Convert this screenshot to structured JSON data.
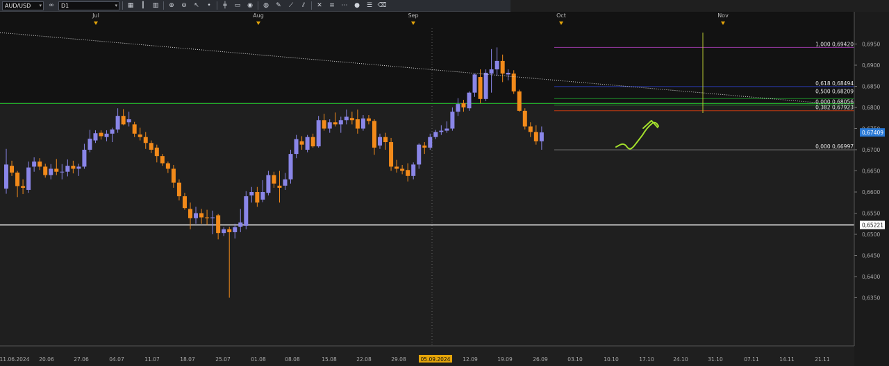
{
  "toolbar": {
    "symbol": "AUD/USD",
    "timeframe": "D1",
    "buttons": [
      {
        "name": "chart-type-icon",
        "glyph": "▦"
      },
      {
        "name": "bar-chart-icon",
        "glyph": "┃"
      },
      {
        "name": "candles-icon",
        "glyph": "▥"
      },
      {
        "name": "zoom-in-icon",
        "glyph": "⊕"
      },
      {
        "name": "zoom-out-icon",
        "glyph": "⊖"
      },
      {
        "name": "cursor-icon",
        "glyph": "↖"
      },
      {
        "name": "dot-icon",
        "glyph": "•"
      },
      {
        "name": "crosshair-icon",
        "glyph": "╪"
      },
      {
        "name": "text-icon",
        "glyph": "▭"
      },
      {
        "name": "eye-icon",
        "glyph": "◉"
      },
      {
        "name": "globe-icon",
        "glyph": "◍"
      },
      {
        "name": "pencil-icon",
        "glyph": "✎"
      },
      {
        "name": "trendline-icon",
        "glyph": "⟋"
      },
      {
        "name": "channel-icon",
        "glyph": "⫽"
      },
      {
        "name": "cross-icon",
        "glyph": "✕"
      },
      {
        "name": "fibonacci-icon",
        "glyph": "≡"
      },
      {
        "name": "grid-icon",
        "glyph": "⋯"
      },
      {
        "name": "circle-icon",
        "glyph": "●"
      },
      {
        "name": "lines-icon",
        "glyph": "☰"
      },
      {
        "name": "eraser-icon",
        "glyph": "⌫"
      }
    ]
  },
  "chart_data": {
    "type": "candlestick",
    "symbol": "AUD/USD",
    "timeframe": "D1",
    "x_labels": [
      "11.06.2024",
      "20.06",
      "27.06",
      "04.07",
      "11.07",
      "18.07",
      "25.07",
      "01.08",
      "08.08",
      "15.08",
      "22.08",
      "29.08",
      "05.09.2024",
      "12.09",
      "19.09",
      "26.09",
      "03.10",
      "10.10",
      "17.10",
      "24.10",
      "31.10",
      "07.11",
      "14.11",
      "21.11"
    ],
    "highlighted_x_label": "05.09.2024",
    "month_labels": [
      "Jul",
      "Aug",
      "Sep",
      "Oct",
      "Nov"
    ],
    "y_ticks": [
      "0,6950",
      "0,6900",
      "0,6850",
      "0,6800",
      "0,6750",
      "0,6700",
      "0,6650",
      "0,6600",
      "0,6550",
      "0,6500",
      "0,6450",
      "0,6400",
      "0,6350"
    ],
    "ylim": [
      0.6331,
      0.6982
    ],
    "current_price": "0,67409",
    "support_price": "0,65221",
    "fibonacci_levels": [
      {
        "label": "1,000 0,69420",
        "value": 0.6942,
        "color": "#9a3aa5"
      },
      {
        "label": "0,618 0,68494",
        "value": 0.68494,
        "color": "#2a3ab0"
      },
      {
        "label": "0,500 0,68209",
        "value": 0.68209,
        "color": "#1f8f2a"
      },
      {
        "label": "0,000 0,68056",
        "value": 0.68056,
        "color": "#1f8f2a"
      },
      {
        "label": "0,382 0,67923",
        "value": 0.67923,
        "color": "#c43a10"
      },
      {
        "label": "0,000 0,66997",
        "value": 0.66997,
        "color": "#7a7a7a"
      }
    ],
    "colors": {
      "bull": "#8a86e8",
      "bear": "#f28a1a",
      "support": "#ffffff",
      "resistance": "#21b42a",
      "arrow": "#a4e02c",
      "trend": "#dddddd",
      "current_tag": "#2a7ad6"
    },
    "candles": [
      {
        "o": 0.6608,
        "h": 0.6702,
        "l": 0.6596,
        "c": 0.6665
      },
      {
        "o": 0.6662,
        "h": 0.6674,
        "l": 0.6638,
        "c": 0.6646
      },
      {
        "o": 0.6646,
        "h": 0.665,
        "l": 0.6588,
        "c": 0.6614
      },
      {
        "o": 0.6614,
        "h": 0.663,
        "l": 0.6595,
        "c": 0.661
      },
      {
        "o": 0.6605,
        "h": 0.6672,
        "l": 0.6598,
        "c": 0.6658
      },
      {
        "o": 0.666,
        "h": 0.6682,
        "l": 0.6648,
        "c": 0.6672
      },
      {
        "o": 0.6672,
        "h": 0.668,
        "l": 0.6652,
        "c": 0.666
      },
      {
        "o": 0.666,
        "h": 0.6667,
        "l": 0.6634,
        "c": 0.664
      },
      {
        "o": 0.664,
        "h": 0.6666,
        "l": 0.663,
        "c": 0.6655
      },
      {
        "o": 0.6655,
        "h": 0.6678,
        "l": 0.664,
        "c": 0.6648
      },
      {
        "o": 0.6648,
        "h": 0.6666,
        "l": 0.663,
        "c": 0.6648
      },
      {
        "o": 0.6648,
        "h": 0.6677,
        "l": 0.6637,
        "c": 0.6662
      },
      {
        "o": 0.6662,
        "h": 0.6674,
        "l": 0.6644,
        "c": 0.6655
      },
      {
        "o": 0.6655,
        "h": 0.6667,
        "l": 0.6638,
        "c": 0.666
      },
      {
        "o": 0.666,
        "h": 0.6714,
        "l": 0.6655,
        "c": 0.67
      },
      {
        "o": 0.67,
        "h": 0.6747,
        "l": 0.6694,
        "c": 0.6726
      },
      {
        "o": 0.6722,
        "h": 0.6746,
        "l": 0.6716,
        "c": 0.6739
      },
      {
        "o": 0.674,
        "h": 0.6746,
        "l": 0.6724,
        "c": 0.6732
      },
      {
        "o": 0.673,
        "h": 0.6746,
        "l": 0.672,
        "c": 0.6738
      },
      {
        "o": 0.6738,
        "h": 0.6752,
        "l": 0.6718,
        "c": 0.6748
      },
      {
        "o": 0.6748,
        "h": 0.6798,
        "l": 0.674,
        "c": 0.678
      },
      {
        "o": 0.678,
        "h": 0.6796,
        "l": 0.6758,
        "c": 0.676
      },
      {
        "o": 0.6765,
        "h": 0.679,
        "l": 0.6755,
        "c": 0.6772
      },
      {
        "o": 0.676,
        "h": 0.6766,
        "l": 0.673,
        "c": 0.6738
      },
      {
        "o": 0.6736,
        "h": 0.6752,
        "l": 0.6722,
        "c": 0.673
      },
      {
        "o": 0.673,
        "h": 0.6742,
        "l": 0.6702,
        "c": 0.6716
      },
      {
        "o": 0.6716,
        "h": 0.6722,
        "l": 0.6692,
        "c": 0.67
      },
      {
        "o": 0.6705,
        "h": 0.6712,
        "l": 0.667,
        "c": 0.6685
      },
      {
        "o": 0.6685,
        "h": 0.669,
        "l": 0.6662,
        "c": 0.6668
      },
      {
        "o": 0.6668,
        "h": 0.6672,
        "l": 0.6645,
        "c": 0.6655
      },
      {
        "o": 0.6655,
        "h": 0.6664,
        "l": 0.661,
        "c": 0.6622
      },
      {
        "o": 0.6622,
        "h": 0.663,
        "l": 0.658,
        "c": 0.659
      },
      {
        "o": 0.659,
        "h": 0.6598,
        "l": 0.6558,
        "c": 0.6562
      },
      {
        "o": 0.656,
        "h": 0.6575,
        "l": 0.6512,
        "c": 0.6538
      },
      {
        "o": 0.6538,
        "h": 0.6565,
        "l": 0.6525,
        "c": 0.655
      },
      {
        "o": 0.655,
        "h": 0.656,
        "l": 0.6525,
        "c": 0.654
      },
      {
        "o": 0.654,
        "h": 0.6558,
        "l": 0.6522,
        "c": 0.6538
      },
      {
        "o": 0.6538,
        "h": 0.6556,
        "l": 0.65,
        "c": 0.654
      },
      {
        "o": 0.6545,
        "h": 0.6548,
        "l": 0.6488,
        "c": 0.6503
      },
      {
        "o": 0.6503,
        "h": 0.6517,
        "l": 0.6496,
        "c": 0.6512
      },
      {
        "o": 0.6512,
        "h": 0.6518,
        "l": 0.635,
        "c": 0.6505
      },
      {
        "o": 0.6505,
        "h": 0.6525,
        "l": 0.649,
        "c": 0.6517
      },
      {
        "o": 0.6518,
        "h": 0.656,
        "l": 0.6505,
        "c": 0.6528
      },
      {
        "o": 0.652,
        "h": 0.6602,
        "l": 0.6512,
        "c": 0.659
      },
      {
        "o": 0.6592,
        "h": 0.6612,
        "l": 0.6575,
        "c": 0.66
      },
      {
        "o": 0.66,
        "h": 0.6612,
        "l": 0.6565,
        "c": 0.6575
      },
      {
        "o": 0.6582,
        "h": 0.6628,
        "l": 0.6576,
        "c": 0.66
      },
      {
        "o": 0.6598,
        "h": 0.665,
        "l": 0.6592,
        "c": 0.664
      },
      {
        "o": 0.664,
        "h": 0.6648,
        "l": 0.661,
        "c": 0.662
      },
      {
        "o": 0.6615,
        "h": 0.665,
        "l": 0.6575,
        "c": 0.661
      },
      {
        "o": 0.6615,
        "h": 0.6645,
        "l": 0.6605,
        "c": 0.663
      },
      {
        "o": 0.663,
        "h": 0.67,
        "l": 0.662,
        "c": 0.669
      },
      {
        "o": 0.669,
        "h": 0.6735,
        "l": 0.668,
        "c": 0.6725
      },
      {
        "o": 0.672,
        "h": 0.6732,
        "l": 0.67,
        "c": 0.6712
      },
      {
        "o": 0.67,
        "h": 0.6735,
        "l": 0.6694,
        "c": 0.673
      },
      {
        "o": 0.673,
        "h": 0.6738,
        "l": 0.6705,
        "c": 0.6708
      },
      {
        "o": 0.6708,
        "h": 0.678,
        "l": 0.6705,
        "c": 0.677
      },
      {
        "o": 0.677,
        "h": 0.6785,
        "l": 0.6745,
        "c": 0.675
      },
      {
        "o": 0.675,
        "h": 0.6772,
        "l": 0.674,
        "c": 0.6765
      },
      {
        "o": 0.6765,
        "h": 0.6788,
        "l": 0.6755,
        "c": 0.676
      },
      {
        "o": 0.676,
        "h": 0.6778,
        "l": 0.674,
        "c": 0.677
      },
      {
        "o": 0.677,
        "h": 0.6795,
        "l": 0.676,
        "c": 0.6778
      },
      {
        "o": 0.6775,
        "h": 0.679,
        "l": 0.676,
        "c": 0.677
      },
      {
        "o": 0.6772,
        "h": 0.6795,
        "l": 0.6738,
        "c": 0.675
      },
      {
        "o": 0.675,
        "h": 0.6782,
        "l": 0.6745,
        "c": 0.6774
      },
      {
        "o": 0.6774,
        "h": 0.6782,
        "l": 0.676,
        "c": 0.6768
      },
      {
        "o": 0.6768,
        "h": 0.6772,
        "l": 0.6688,
        "c": 0.6705
      },
      {
        "o": 0.671,
        "h": 0.6738,
        "l": 0.6702,
        "c": 0.673
      },
      {
        "o": 0.673,
        "h": 0.674,
        "l": 0.67,
        "c": 0.6718
      },
      {
        "o": 0.6718,
        "h": 0.6728,
        "l": 0.665,
        "c": 0.666
      },
      {
        "o": 0.666,
        "h": 0.6676,
        "l": 0.6646,
        "c": 0.6655
      },
      {
        "o": 0.6655,
        "h": 0.6664,
        "l": 0.6642,
        "c": 0.665
      },
      {
        "o": 0.6652,
        "h": 0.6668,
        "l": 0.6625,
        "c": 0.6638
      },
      {
        "o": 0.6638,
        "h": 0.667,
        "l": 0.663,
        "c": 0.6665
      },
      {
        "o": 0.6665,
        "h": 0.6715,
        "l": 0.6655,
        "c": 0.6712
      },
      {
        "o": 0.671,
        "h": 0.6718,
        "l": 0.669,
        "c": 0.6705
      },
      {
        "o": 0.6705,
        "h": 0.6738,
        "l": 0.67,
        "c": 0.673
      },
      {
        "o": 0.673,
        "h": 0.6747,
        "l": 0.6725,
        "c": 0.6742
      },
      {
        "o": 0.6742,
        "h": 0.6758,
        "l": 0.6735,
        "c": 0.6745
      },
      {
        "o": 0.6745,
        "h": 0.6767,
        "l": 0.674,
        "c": 0.675
      },
      {
        "o": 0.675,
        "h": 0.68,
        "l": 0.6745,
        "c": 0.679
      },
      {
        "o": 0.679,
        "h": 0.6822,
        "l": 0.678,
        "c": 0.6808
      },
      {
        "o": 0.681,
        "h": 0.6818,
        "l": 0.679,
        "c": 0.68
      },
      {
        "o": 0.6798,
        "h": 0.6838,
        "l": 0.6792,
        "c": 0.6835
      },
      {
        "o": 0.6835,
        "h": 0.688,
        "l": 0.6825,
        "c": 0.6878
      },
      {
        "o": 0.6872,
        "h": 0.689,
        "l": 0.681,
        "c": 0.682
      },
      {
        "o": 0.682,
        "h": 0.689,
        "l": 0.6815,
        "c": 0.6882
      },
      {
        "o": 0.688,
        "h": 0.6938,
        "l": 0.6835,
        "c": 0.689
      },
      {
        "o": 0.689,
        "h": 0.6942,
        "l": 0.6875,
        "c": 0.691
      },
      {
        "o": 0.691,
        "h": 0.6925,
        "l": 0.686,
        "c": 0.688
      },
      {
        "o": 0.6878,
        "h": 0.689,
        "l": 0.6864,
        "c": 0.6882
      },
      {
        "o": 0.688,
        "h": 0.6888,
        "l": 0.6832,
        "c": 0.6838
      },
      {
        "o": 0.6838,
        "h": 0.6842,
        "l": 0.679,
        "c": 0.6792
      },
      {
        "o": 0.6792,
        "h": 0.6798,
        "l": 0.6748,
        "c": 0.6755
      },
      {
        "o": 0.6755,
        "h": 0.6765,
        "l": 0.673,
        "c": 0.6742
      },
      {
        "o": 0.6742,
        "h": 0.6758,
        "l": 0.6712,
        "c": 0.672
      },
      {
        "o": 0.672,
        "h": 0.6755,
        "l": 0.67,
        "c": 0.6741
      }
    ]
  }
}
